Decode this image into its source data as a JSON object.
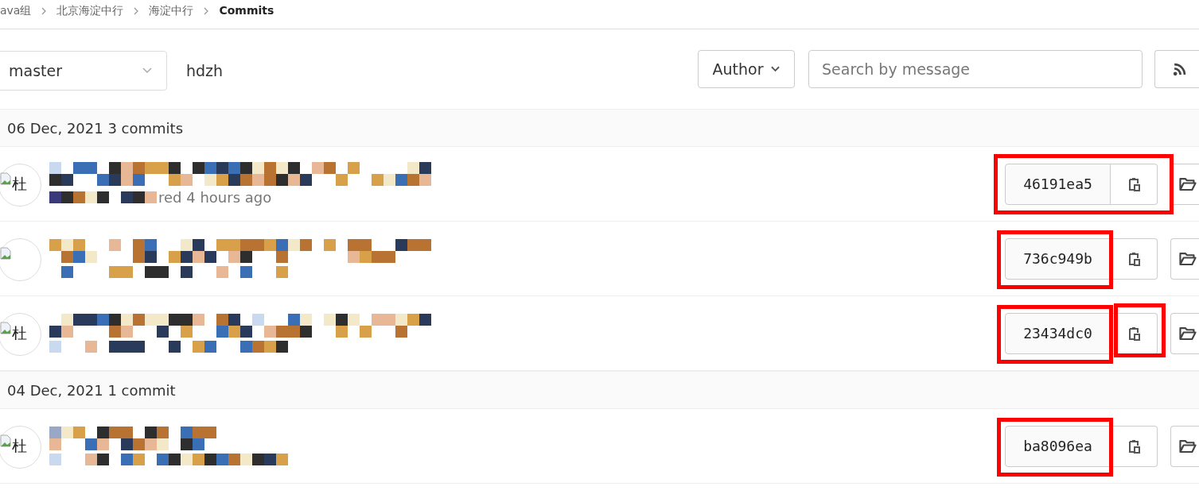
{
  "breadcrumb": [
    {
      "label": "ava组",
      "current": false
    },
    {
      "label": "北京海淀中行",
      "current": false
    },
    {
      "label": "海淀中行",
      "current": false
    },
    {
      "label": "Commits",
      "current": true
    }
  ],
  "filters": {
    "branch": "master",
    "path": "hdzh",
    "author_button": "Author",
    "search": {
      "placeholder": "Search by message"
    }
  },
  "groups": [
    {
      "date": "06 Dec, 2021 3 commits",
      "commits": [
        {
          "avatar_alt": "杜",
          "meta": "red 4 hours ago",
          "sha": "46191ea5",
          "sha_marked": true,
          "copy_marked": true,
          "marks_joined": true
        },
        {
          "sha": "736c949b",
          "sha_marked": true,
          "copy_marked": false,
          "marks_joined": false
        },
        {
          "avatar_alt": "杜",
          "sha": "23434dc0",
          "sha_marked": true,
          "copy_marked": true,
          "marks_joined": false
        }
      ]
    },
    {
      "date": "04 Dec, 2021 1 commit",
      "commits": [
        {
          "avatar_alt": "杜",
          "sha": "ba8096ea",
          "sha_marked": true,
          "copy_marked": false,
          "marks_joined": false
        }
      ]
    }
  ]
}
